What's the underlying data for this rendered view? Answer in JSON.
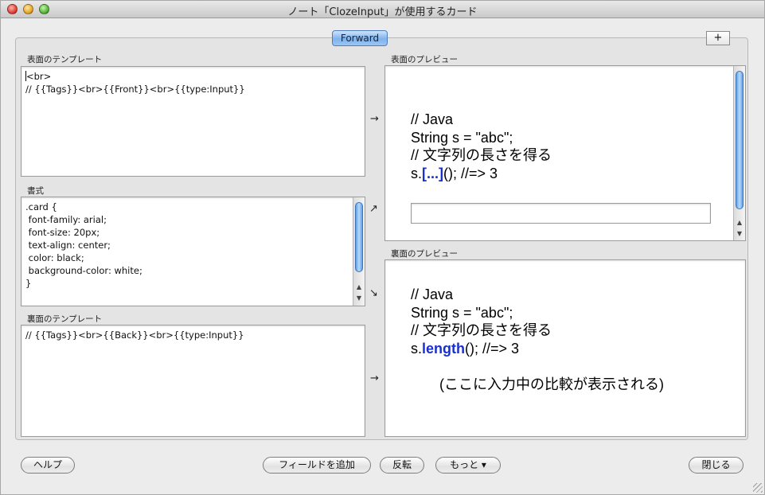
{
  "window": {
    "title": "ノート「ClozeInput」が使用するカード"
  },
  "tabs": {
    "active_label": "Forward",
    "add_label": "+"
  },
  "front_template": {
    "label": "表面のテンプレート",
    "lines": [
      "<br>",
      "// {{Tags}}<br>{{Front}}<br>{{type:Input}}"
    ]
  },
  "styling": {
    "label": "書式",
    "lines": [
      ".card {",
      " font-family: arial;",
      " font-size: 20px;",
      " text-align: center;",
      " color: black;",
      " background-color: white;",
      "}"
    ]
  },
  "back_template": {
    "label": "裏面のテンプレート",
    "lines": [
      "// {{Tags}}<br>{{Back}}<br>{{type:Input}}"
    ]
  },
  "front_preview": {
    "label": "表面のプレビュー",
    "line1": "// Java",
    "line2": "String s = \"abc\";",
    "line3": "// 文字列の長さを得る",
    "line4_prefix": "s.",
    "line4_cloze": "[...]",
    "line4_suffix": "(); //=> 3"
  },
  "back_preview": {
    "label": "裏面のプレビュー",
    "line1": "// Java",
    "line2": "String s = \"abc\";",
    "line3": "// 文字列の長さを得る",
    "line4_prefix": "s.",
    "line4_cloze": "length",
    "line4_suffix": "(); //=> 3",
    "note": "(ここに入力中の比較が表示される)"
  },
  "arrows": {
    "front": "→",
    "styling_up": "↗",
    "styling_down": "↘",
    "back": "→"
  },
  "buttons": {
    "help": "ヘルプ",
    "add_field": "フィールドを追加",
    "flip": "反転",
    "more": "もっと ▾",
    "close": "閉じる"
  },
  "colors": {
    "cloze": "#1a2fd0",
    "tab_accent": "#7fb2ec"
  }
}
